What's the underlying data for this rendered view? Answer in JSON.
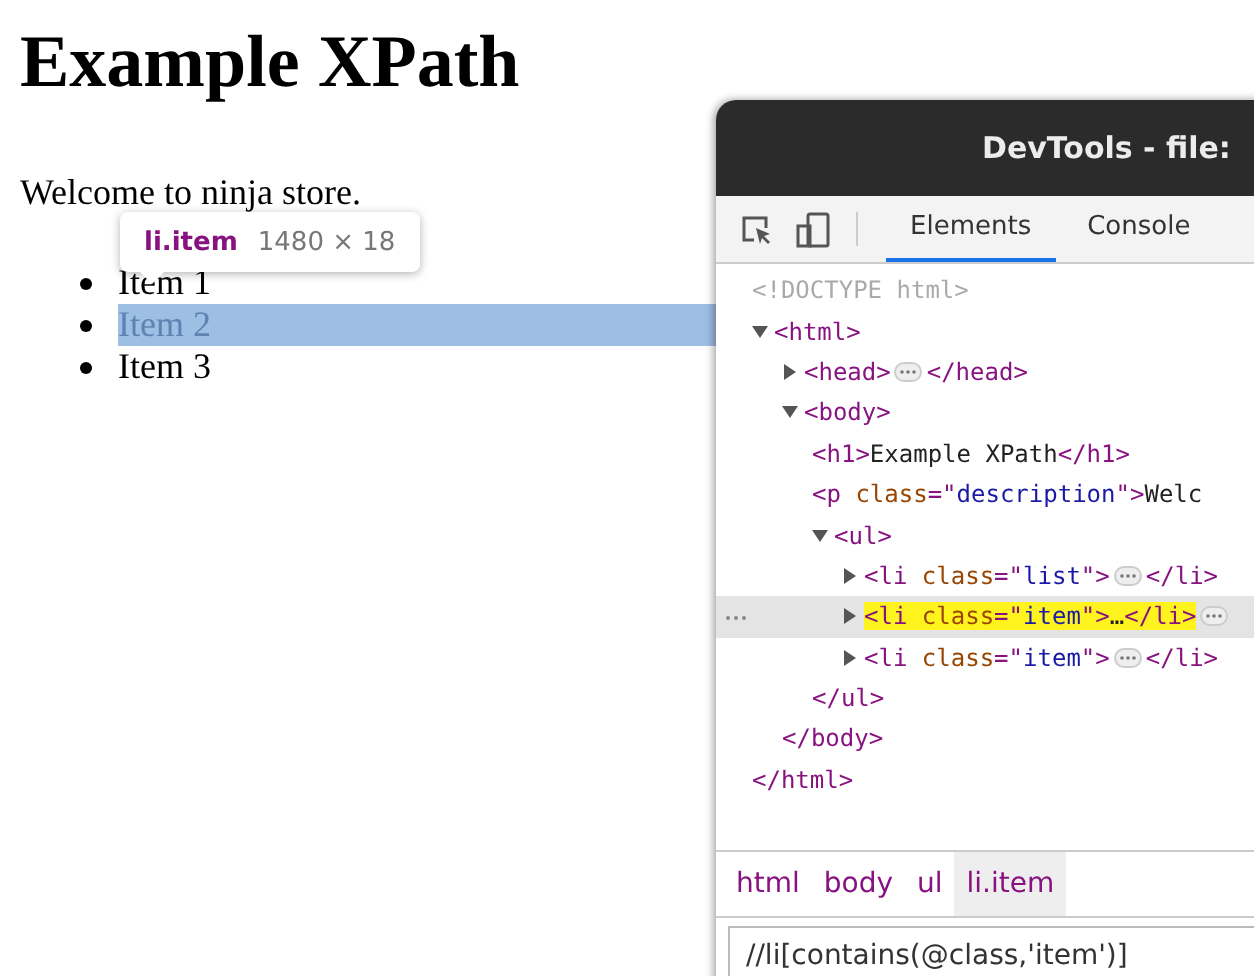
{
  "page": {
    "heading": "Example XPath",
    "paragraph": "Welcome to ninja store.",
    "items": [
      {
        "text": "Item 1",
        "highlighted": false
      },
      {
        "text": "Item 2",
        "highlighted": true
      },
      {
        "text": "Item 3",
        "highlighted": false
      }
    ]
  },
  "tooltip": {
    "selector": "li.item",
    "size": "1480 × 18"
  },
  "devtools": {
    "title": "DevTools - file:",
    "tabs": [
      {
        "label": "Elements",
        "selected": true
      },
      {
        "label": "Console",
        "selected": false
      }
    ],
    "dom": [
      {
        "kind": "doctype",
        "line": "<!DOCTYPE html>",
        "selected": false
      },
      {
        "kind": "element",
        "line": "<html>",
        "end": "</html>",
        "expanded": true,
        "selected": false,
        "children": [
          {
            "kind": "element",
            "line": "<head>",
            "end": "</head>",
            "expanded": false,
            "selected": false
          },
          {
            "kind": "element",
            "line": "<body>",
            "end": "</body>",
            "expanded": true,
            "selected": false,
            "children": [
              {
                "kind": "element",
                "line": "<h1>Example XPath</h1>",
                "selected": false
              },
              {
                "kind": "element",
                "line": "<p class=\"description\">Welc",
                "selected": false
              },
              {
                "kind": "element",
                "line": "<ul>",
                "end": "</ul>",
                "expanded": true,
                "selected": false,
                "children": [
                  {
                    "kind": "element",
                    "line": "<li class=\"list\">",
                    "end": "</li>",
                    "expanded": false,
                    "selected": false
                  },
                  {
                    "kind": "element",
                    "line": "<li class=\"item\">…</li>",
                    "expanded": false,
                    "selected": true
                  },
                  {
                    "kind": "element",
                    "line": "<li class=\"item\">",
                    "end": "</li>",
                    "expanded": false,
                    "selected": false
                  }
                ]
              }
            ]
          }
        ]
      }
    ],
    "breadcrumbs": [
      {
        "label": "html",
        "selected": false
      },
      {
        "label": "body",
        "selected": false
      },
      {
        "label": "ul",
        "selected": false
      },
      {
        "label": "li.item",
        "selected": true
      }
    ],
    "search": {
      "value": "//li[contains(@class,'item')]"
    }
  }
}
